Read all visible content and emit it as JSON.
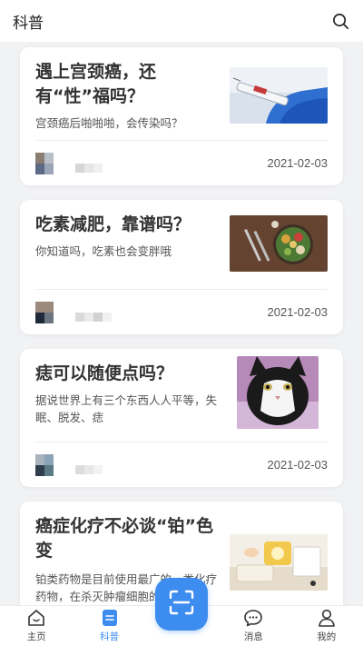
{
  "header": {
    "title": "科普"
  },
  "articles": [
    {
      "title": "遇上宫颈癌，还有“性”福吗？",
      "summary": "宫颈癌后啪啪啪，会传染吗？",
      "date": "2021-02-03",
      "thumb_icon": "vaccine-photo"
    },
    {
      "title": "吃素减肥，靠谱吗？",
      "summary": "你知道吗，吃素也会变胖哦",
      "date": "2021-02-03",
      "thumb_icon": "salad-bowl-photo"
    },
    {
      "title": "痣可以随便点吗？",
      "summary": "据说世界上有三个东西人人平等，失眠、脱发、痣",
      "date": "2021-02-03",
      "thumb_icon": "cat-photo"
    },
    {
      "title": "癌症化疗不必谈“铂”色变",
      "summary": "铂类药物是目前使用最广的一类化疗药物，在杀灭肿瘤细胞的同",
      "date": "",
      "thumb_icon": "medicine-photo"
    }
  ],
  "tabs": [
    {
      "label": "主页",
      "icon": "home-icon",
      "active": false
    },
    {
      "label": "科普",
      "icon": "article-icon",
      "active": true
    },
    {
      "label": "消息",
      "icon": "message-icon",
      "active": false
    },
    {
      "label": "我的",
      "icon": "profile-icon",
      "active": false
    }
  ],
  "colors": {
    "accent": "#3d8cf0",
    "background": "#f1f2f4"
  }
}
